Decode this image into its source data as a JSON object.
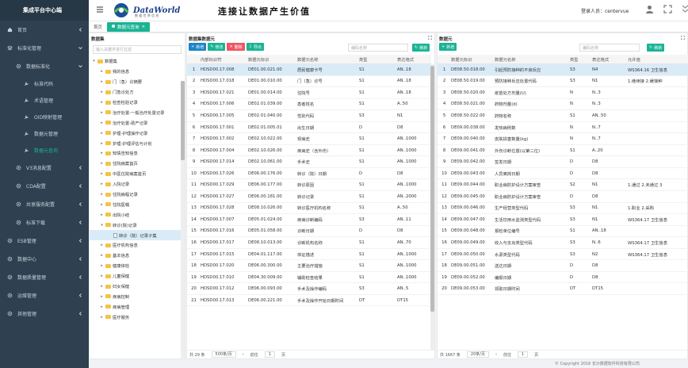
{
  "sidebar": {
    "title": "集成平台中心端",
    "items": [
      {
        "label": "首页",
        "icon": "home-icon",
        "level": 0
      },
      {
        "label": "标准化管理",
        "icon": "layers-icon",
        "level": 0,
        "expanded": true
      },
      {
        "label": "数据标准化",
        "icon": "gear-icon",
        "level": 1,
        "expanded": true
      },
      {
        "label": "标准代码",
        "icon": "wrench-icon",
        "level": 2
      },
      {
        "label": "术语管理",
        "icon": "wrench-icon",
        "level": 2
      },
      {
        "label": "OID映射管理",
        "icon": "wrench-icon",
        "level": 2
      },
      {
        "label": "数据元管理",
        "icon": "wrench-icon",
        "level": 2
      },
      {
        "label": "数据元查询",
        "icon": "wrench-icon",
        "level": 2,
        "active": true
      },
      {
        "label": "V3消息配置",
        "icon": "gear-icon",
        "level": 1
      },
      {
        "label": "CDA配置",
        "icon": "gear-icon",
        "level": 1
      },
      {
        "label": "共享服务配置",
        "icon": "gear-icon",
        "level": 1
      },
      {
        "label": "标准下载",
        "icon": "gear-icon",
        "level": 1
      },
      {
        "label": "ESB管理",
        "icon": "gear-icon",
        "level": 0
      },
      {
        "label": "数据中心",
        "icon": "gear-icon",
        "level": 0
      },
      {
        "label": "数据质量管理",
        "icon": "gear-icon",
        "level": 0
      },
      {
        "label": "运维管理",
        "icon": "gear-icon",
        "level": 0
      },
      {
        "label": "其他管理",
        "icon": "gear-icon",
        "level": 0
      }
    ]
  },
  "header": {
    "brand": "DataWorld",
    "brand_sub": "数 据 世 界 信 息",
    "slogan": "连接让数据产生价值",
    "user": "登录人员：centervue"
  },
  "tabs": [
    {
      "label": "首页",
      "active": false
    },
    {
      "label": "数据元查询",
      "active": true
    }
  ],
  "tree_panel": {
    "title": "数据集",
    "search_placeholder": "输入关键字进行过滤",
    "nodes": [
      {
        "label": "数据集",
        "level": 0,
        "type": "folder",
        "toggle": "▾"
      },
      {
        "label": "我的信息",
        "level": 1,
        "type": "folder",
        "toggle": "▸"
      },
      {
        "label": "门（急）诊摘要",
        "level": 1,
        "type": "folder",
        "toggle": "▸"
      },
      {
        "label": "门急诊处方",
        "level": 1,
        "type": "folder",
        "toggle": "▸"
      },
      {
        "label": "检查检验记录",
        "level": 1,
        "type": "folder",
        "toggle": "▸"
      },
      {
        "label": "治疗处置-一般治疗处置记录",
        "level": 1,
        "type": "folder",
        "toggle": "▸"
      },
      {
        "label": "治疗处置-助产记录",
        "level": 1,
        "type": "folder",
        "toggle": "▸"
      },
      {
        "label": "护理-护理操作记录",
        "level": 1,
        "type": "folder",
        "toggle": "▸"
      },
      {
        "label": "护理-护理评估与计划",
        "level": 1,
        "type": "folder",
        "toggle": "▸"
      },
      {
        "label": "知情告知信息",
        "level": 1,
        "type": "folder",
        "toggle": "▸"
      },
      {
        "label": "住院病案首页",
        "level": 1,
        "type": "folder",
        "toggle": "▸"
      },
      {
        "label": "中医住院病案首页",
        "level": 1,
        "type": "folder",
        "toggle": "▸"
      },
      {
        "label": "入院记录",
        "level": 1,
        "type": "folder",
        "toggle": "▸"
      },
      {
        "label": "住院病程记录",
        "level": 1,
        "type": "folder",
        "toggle": "▸"
      },
      {
        "label": "住院医嘱",
        "level": 1,
        "type": "folder",
        "toggle": "▸"
      },
      {
        "label": "出院小结",
        "level": 1,
        "type": "folder",
        "toggle": "▸"
      },
      {
        "label": "转诊(院)记录",
        "level": 1,
        "type": "folder",
        "toggle": "▾"
      },
      {
        "label": "转诊（院）记录子集",
        "level": 2,
        "type": "file",
        "toggle": "",
        "selected": true
      },
      {
        "label": "医疗机构信息",
        "level": 1,
        "type": "folder",
        "toggle": "▸"
      },
      {
        "label": "基本信息",
        "level": 1,
        "type": "folder",
        "toggle": "▸"
      },
      {
        "label": "健康体检",
        "level": 1,
        "type": "folder",
        "toggle": "▸"
      },
      {
        "label": "儿童保健",
        "level": 1,
        "type": "folder",
        "toggle": "▸"
      },
      {
        "label": "妇女保健",
        "level": 1,
        "type": "folder",
        "toggle": "▸"
      },
      {
        "label": "疾病控制",
        "level": 1,
        "type": "folder",
        "toggle": "▸"
      },
      {
        "label": "疾病管理",
        "level": 1,
        "type": "folder",
        "toggle": "▸"
      },
      {
        "label": "医疗服务",
        "level": 1,
        "type": "folder",
        "toggle": "▸"
      }
    ]
  },
  "mid_panel": {
    "title": "数据集数据元",
    "buttons": {
      "add": "新增",
      "edit": "修改",
      "del": "删除",
      "export": "导出",
      "refresh": "刷新"
    },
    "search_placeholder": "编码名称",
    "columns": [
      "",
      "内部标识符",
      "数据元标识",
      "数据元名称",
      "类型",
      "表达格式"
    ],
    "rows": [
      [
        "1",
        "HDSD00.17.008",
        "DE01.00.021.00",
        "居民健康卡号",
        "S1",
        "AN..18"
      ],
      [
        "2",
        "HDSD00.17.018",
        "DE01.00.010.00",
        "门（急）诊号",
        "S1",
        "AN..18"
      ],
      [
        "3",
        "HDSD00.17.021",
        "DE01.00.014.00",
        "住院号",
        "S1",
        "AN..18"
      ],
      [
        "4",
        "HDSD00.17.006",
        "DE02.01.039.00",
        "患者姓名",
        "S1",
        "A..50"
      ],
      [
        "5",
        "HDSD00.17.005",
        "DE02.01.040.00",
        "性别代码",
        "S3",
        "N1"
      ],
      [
        "6",
        "HDSD00.17.001",
        "DE02.01.005.01",
        "出生日期",
        "D",
        "D8"
      ],
      [
        "7",
        "HDSD00.17.002",
        "DE02.10.022.00",
        "现病史",
        "S1",
        "AN..1000"
      ],
      [
        "8",
        "HDSD00.17.004",
        "DE02.10.026.00",
        "疾病史（含外伤）",
        "S1",
        "AN..1000"
      ],
      [
        "9",
        "HDSD00.17.014",
        "DE02.10.061.00",
        "手术史",
        "S1",
        "AN..1000"
      ],
      [
        "10",
        "HDSD00.17.026",
        "DE06.00.176.00",
        "转诊（院）日期",
        "D",
        "D8"
      ],
      [
        "11",
        "HDSD00.17.029",
        "DE06.00.177.00",
        "转诊原因",
        "S1",
        "AN..1000"
      ],
      [
        "12",
        "HDSD00.17.027",
        "DE06.00.181.00",
        "转诊记录",
        "S1",
        "AN..2000"
      ],
      [
        "13",
        "HDSD00.17.028",
        "DE08.10.026.00",
        "转诊医疗机构名称",
        "S1",
        "A..50"
      ],
      [
        "14",
        "HDSD00.17.007",
        "DE05.01.024.00",
        "疾病诊断编码",
        "S3",
        "AN..11"
      ],
      [
        "15",
        "HDSD00.17.016",
        "DE05.01.058.00",
        "诊断日期",
        "D",
        "D8"
      ],
      [
        "16",
        "HDSD00.17.017",
        "DE08.10.013.00",
        "诊断机构名称",
        "S1",
        "AN..70"
      ],
      [
        "17",
        "HDSD00.17.015",
        "DE04.01.117.00",
        "体征描述",
        "S1",
        "AN..1000"
      ],
      [
        "18",
        "HDSD00.17.020",
        "DE06.00.300.00",
        "主要治疗措施",
        "S1",
        "AN..1000"
      ],
      [
        "19",
        "HDSD00.17.010",
        "DE04.30.009.00",
        "辅助检查结果",
        "S1",
        "AN..1000"
      ],
      [
        "20",
        "HDSD00.17.012",
        "DE06.00.093.00",
        "手术及操作编码",
        "S3",
        "AN..5"
      ],
      [
        "21",
        "HDSD00.17.013",
        "DE06.00.221.00",
        "手术及操作开始日期时间",
        "DT",
        "DT15"
      ]
    ],
    "total": "共 29 条",
    "page_size": "500条/页",
    "goto": "前往",
    "page": "1",
    "unit": "页"
  },
  "right_panel": {
    "title": "数据元",
    "buttons": {
      "add": "新增",
      "refresh": "刷新"
    },
    "search_placeholder": "编码名称",
    "columns": [
      "",
      "数据元标识",
      "数据元名称",
      "类型",
      "表达格式",
      "允许值"
    ],
    "rows": [
      [
        "1",
        "DE08.50.018.00",
        "引起预防接种的不良反应",
        "S3",
        "N4",
        "WS364.16 卫生信息"
      ],
      [
        "2",
        "DE08.50.019.00",
        "预防接种反应处置代码",
        "S3",
        "N1",
        "1.继续接 2.缓接种"
      ],
      [
        "3",
        "DE08.50.020.00",
        "疫苗处方剂量(U)",
        "N",
        "N..3",
        ""
      ],
      [
        "4",
        "DE08.50.021.00",
        "药物剂量(d)",
        "N",
        "N..3",
        ""
      ],
      [
        "5",
        "DE08.50.022.00",
        "药物名称",
        "S1",
        "AN..50",
        ""
      ],
      [
        "6",
        "DE09.00.038.00",
        "发热病例数",
        "N",
        "N..7",
        ""
      ],
      [
        "7",
        "DE09.00.040.00",
        "皮肤损害数量(kg)",
        "N",
        "N..7",
        ""
      ],
      [
        "8",
        "DE09.00.041.00",
        "外伤诊断位置(以第二位)",
        "S1",
        "A..20",
        ""
      ],
      [
        "9",
        "DE09.00.042.00",
        "签发日期",
        "D",
        "D8",
        ""
      ],
      [
        "10",
        "DE09.00.043.00",
        "人员离岗日期",
        "D",
        "D8",
        ""
      ],
      [
        "11",
        "DE09.00.044.00",
        "职业病防护设计方案审查",
        "S2",
        "N1",
        "1.通过 2.未通过 3"
      ],
      [
        "12",
        "DE09.00.045.00",
        "职业病防护设计方案审查",
        "D",
        "D8",
        ""
      ],
      [
        "13",
        "DE09.00.046.00",
        "生产经营类型代码",
        "S3",
        "N1",
        "1.职业 2.采购"
      ],
      [
        "14",
        "DE09.00.047.00",
        "生活饮用水监测类型代码",
        "S3",
        "N1",
        "WS364.17 卫生信息"
      ],
      [
        "15",
        "DE09.00.048.00",
        "报检单位编号",
        "S1",
        "AN..18",
        ""
      ],
      [
        "16",
        "DE09.00.049.00",
        "收入与支出类型代码",
        "S3",
        "N..6",
        "WS364.17 卫生信息"
      ],
      [
        "17",
        "DE09.00.050.00",
        "水源类型代码",
        "S3",
        "N2",
        "WS364.17 卫生信息"
      ],
      [
        "18",
        "DE09.00.051.00",
        "送达日期",
        "D",
        "D8",
        ""
      ],
      [
        "19",
        "DE09.00.052.00",
        "编报日期",
        "D",
        "D8",
        ""
      ],
      [
        "20",
        "DE09.00.053.00",
        "领取日期时间",
        "DT",
        "DT15",
        ""
      ]
    ],
    "total": "共 1667 条",
    "page_size": "20条/页",
    "goto": "前往",
    "page": "1",
    "unit": "页"
  },
  "footer": "© Copyright 2016 长沙数据软件科技有限公司",
  "colors": {
    "sidebar": "#2f4050",
    "accent": "#1ab394",
    "primary": "#1c84c6",
    "danger": "#ed5565"
  }
}
